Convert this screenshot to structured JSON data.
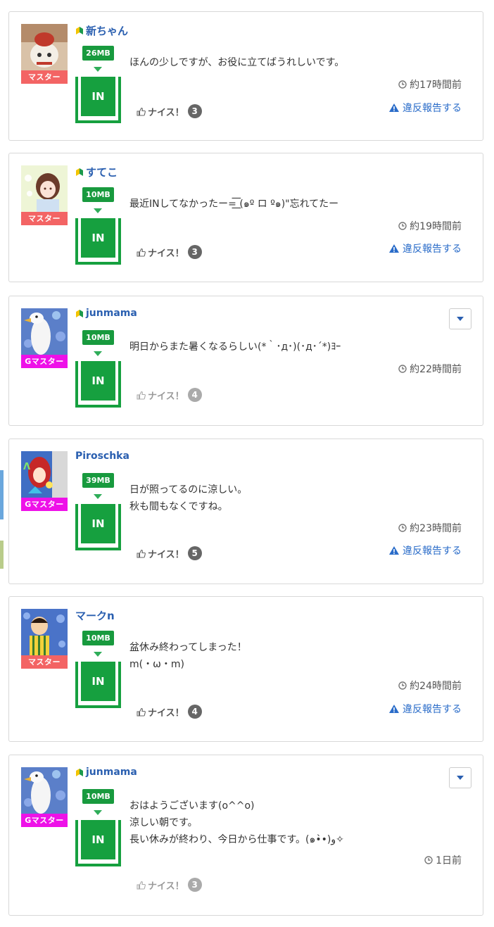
{
  "posts": [
    {
      "user": "新ちゃん",
      "rank": "マスター",
      "size": "26MB",
      "in_label": "IN",
      "message": [
        "ほんの少しですが、お役に立てばうれしいです。"
      ],
      "time": "約17時間前",
      "nice_label": "ナイス！",
      "nice_count": "3",
      "report": "違反報告する"
    },
    {
      "user": "すてこ",
      "rank": "マスター",
      "size": "10MB",
      "in_label": "IN",
      "message": [
        "最近INしてなかったー=͟͟͞͞ (๑º ロ º๑)\"忘れてたー"
      ],
      "time": "約19時間前",
      "nice_label": "ナイス！",
      "nice_count": "3",
      "report": "違反報告する"
    },
    {
      "user": "junmama",
      "rank": "Gマスター",
      "size": "10MB",
      "in_label": "IN",
      "message": [
        "明日からまた暑くなるらしい(*｀･д･)(･д･´*)ﾖｰ"
      ],
      "time": "約22時間前",
      "nice_label": "ナイス！",
      "nice_count": "4"
    },
    {
      "user": "Piroschka",
      "rank": "Gマスター",
      "size": "39MB",
      "in_label": "IN",
      "message": [
        "日が照ってるのに涼しい。",
        "秋も間もなくですね。"
      ],
      "time": "約23時間前",
      "nice_label": "ナイス！",
      "nice_count": "5",
      "report": "違反報告する"
    },
    {
      "user": "マークn",
      "rank": "マスター",
      "size": "10MB",
      "in_label": "IN",
      "message": [
        "盆休み終わってしまった！",
        "m(・ω・m)"
      ],
      "time": "約24時間前",
      "nice_label": "ナイス！",
      "nice_count": "4",
      "report": "違反報告する"
    },
    {
      "user": "junmama",
      "rank": "Gマスター",
      "size": "10MB",
      "in_label": "IN",
      "message": [
        "おはようございます(o^^o)",
        "涼しい朝です。",
        "長い休みが終わり、今日から仕事です。(๑•̀•)و✧"
      ],
      "time": "1日前",
      "nice_label": "ナイス！",
      "nice_count": "3"
    }
  ],
  "colors": {
    "link": "#2a5fb0",
    "in_green": "#16a03f",
    "master": "#f36464",
    "gmaster": "#ee11e8"
  }
}
